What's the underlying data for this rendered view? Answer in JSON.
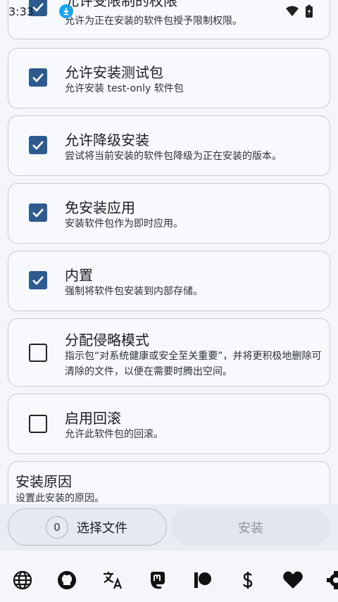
{
  "status": {
    "time": "3:33"
  },
  "options": [
    {
      "title": "允许受限制的权限",
      "desc": "允许为正在安装的软件包授予限制权限。",
      "checked": true
    },
    {
      "title": "允许安装测试包",
      "desc": "允许安装 test-only 软件包",
      "checked": true
    },
    {
      "title": "允许降级安装",
      "desc": "尝试将当前安装的软件包降级为正在安装的版本。",
      "checked": true
    },
    {
      "title": "免安装应用",
      "desc": "安装软件包作为即时应用。",
      "checked": true
    },
    {
      "title": "内置",
      "desc": "强制将软件包安装到内部存储。",
      "checked": true
    },
    {
      "title": "分配侵略模式",
      "desc": "指示包“对系统健康或安全至关重要”，并将更积极地删除可清除的文件，以便在需要时腾出空间。",
      "checked": false
    },
    {
      "title": "启用回滚",
      "desc": "允许此软件包的回滚。",
      "checked": false
    }
  ],
  "reason": {
    "title": "安装原因",
    "desc": "设置此安装的原因。"
  },
  "actions": {
    "count": "0",
    "select_label": "选择文件",
    "install_label": "安装"
  },
  "nav_icons": [
    "globe-icon",
    "github-icon",
    "translate-icon",
    "mastodon-icon",
    "patreon-icon",
    "dollar-icon",
    "heart-icon",
    "settings-icon"
  ]
}
